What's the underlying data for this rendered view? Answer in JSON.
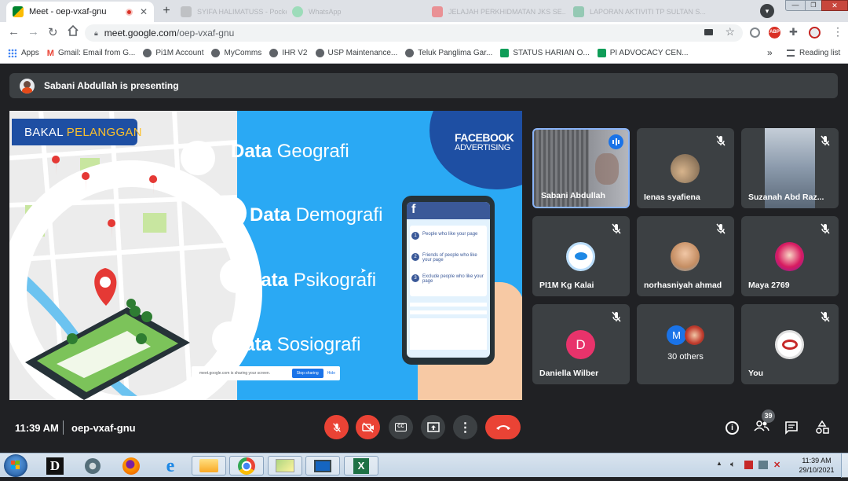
{
  "browser": {
    "tabs": [
      {
        "label": "Meet - oep-vxaf-gnu",
        "active": true
      },
      {
        "label": "SYIFA HALIMATUSS - Pocket P...",
        "active": false
      },
      {
        "label": "WhatsApp",
        "active": false
      },
      {
        "label": "JELAJAH PERKHIDMATAN JKS SE...",
        "active": false
      },
      {
        "label": "LAPORAN AKTIVITI TP SULTAN S...",
        "active": false
      }
    ],
    "url_host": "meet.google.com",
    "url_path": "/oep-vxaf-gnu",
    "bookmarks": [
      {
        "label": "Apps",
        "color": "#4285f4"
      },
      {
        "label": "Gmail: Email from G...",
        "color": "#ea4335"
      },
      {
        "label": "Pi1M Account",
        "color": "#5f6368"
      },
      {
        "label": "MyComms",
        "color": "#5f6368"
      },
      {
        "label": "IHR V2",
        "color": "#5f6368"
      },
      {
        "label": "USP Maintenance...",
        "color": "#5f6368"
      },
      {
        "label": "Teluk Panglima Gar...",
        "color": "#5f6368"
      },
      {
        "label": "STATUS HARIAN O...",
        "color": "#0f9d58"
      },
      {
        "label": "PI ADVOCACY CEN...",
        "color": "#0f9d58"
      }
    ],
    "reading_list": "Reading list",
    "more": "»"
  },
  "meet": {
    "presenting_text": "Sabani Abdullah is presenting",
    "slide": {
      "badge_a": "BAKAL ",
      "badge_b": "PELANGGAN",
      "fb_line1": "FACEBOOK",
      "fb_line2": "ADVERTISING",
      "items": [
        {
          "bold": "Data",
          "rest": " Geografi"
        },
        {
          "bold": "Data",
          "rest": " Demografi"
        },
        {
          "bold": "Data",
          "rest": " Psikografi"
        },
        {
          "bold": "Data",
          "rest": " Sosiografi"
        }
      ],
      "phone_list": [
        "People who like your page",
        "Friends of people who like your page",
        "Exclude people who like your page"
      ],
      "share_text": "meet.google.com is sharing your screen.",
      "stop_sharing": "Stop sharing",
      "hide": "Hide"
    },
    "participants": [
      {
        "name": "Sabani Abdullah",
        "speaking": true
      },
      {
        "name": "Ienas syafiena"
      },
      {
        "name": "Suzanah Abd Raz..."
      },
      {
        "name": "PI1M Kg Kalai"
      },
      {
        "name": "norhasniyah ahmad"
      },
      {
        "name": "Maya 2769"
      },
      {
        "name": "Daniella Wilber",
        "initial": "D",
        "color": "#e8336b"
      },
      {
        "name": "30 others",
        "initial": "M",
        "color": "#1a73e8"
      },
      {
        "name": "You"
      }
    ],
    "time": "11:39 AM",
    "meeting_code": "oep-vxaf-gnu",
    "people_count": "39"
  },
  "taskbar": {
    "clock_time": "11:39 AM",
    "clock_date": "29/10/2021"
  }
}
